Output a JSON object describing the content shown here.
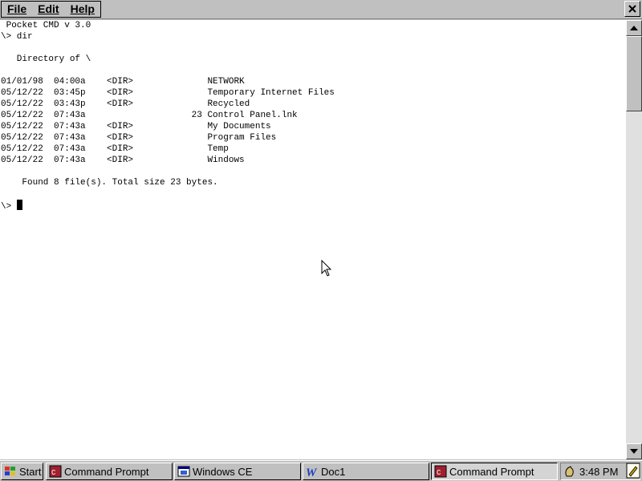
{
  "menu": {
    "file": "File",
    "edit": "Edit",
    "help": "Help"
  },
  "console": {
    "lines": [
      " Pocket CMD v 3.0",
      "\\> dir",
      "",
      "   Directory of \\",
      "",
      "01/01/98  04:00a    <DIR>              NETWORK",
      "05/12/22  03:45p    <DIR>              Temporary Internet Files",
      "05/12/22  03:43p    <DIR>              Recycled",
      "05/12/22  07:43a                    23 Control Panel.lnk",
      "05/12/22  07:43a    <DIR>              My Documents",
      "05/12/22  07:43a    <DIR>              Program Files",
      "05/12/22  07:43a    <DIR>              Temp",
      "05/12/22  07:43a    <DIR>              Windows",
      "",
      "    Found 8 file(s). Total size 23 bytes.",
      ""
    ],
    "prompt": "\\> "
  },
  "taskbar": {
    "start_label": "Start",
    "tasks": [
      {
        "label": "Command Prompt",
        "icon": "command-prompt-icon"
      },
      {
        "label": "Windows CE",
        "icon": "windows-explorer-icon"
      },
      {
        "label": "Doc1",
        "icon": "pocket-word-icon"
      },
      {
        "label": "Command Prompt",
        "icon": "command-prompt-icon"
      }
    ],
    "clock": "3:48 PM"
  },
  "colors": {
    "chrome": "#c0c0c0",
    "console_bg": "#ffffff",
    "console_fg": "#000000"
  }
}
